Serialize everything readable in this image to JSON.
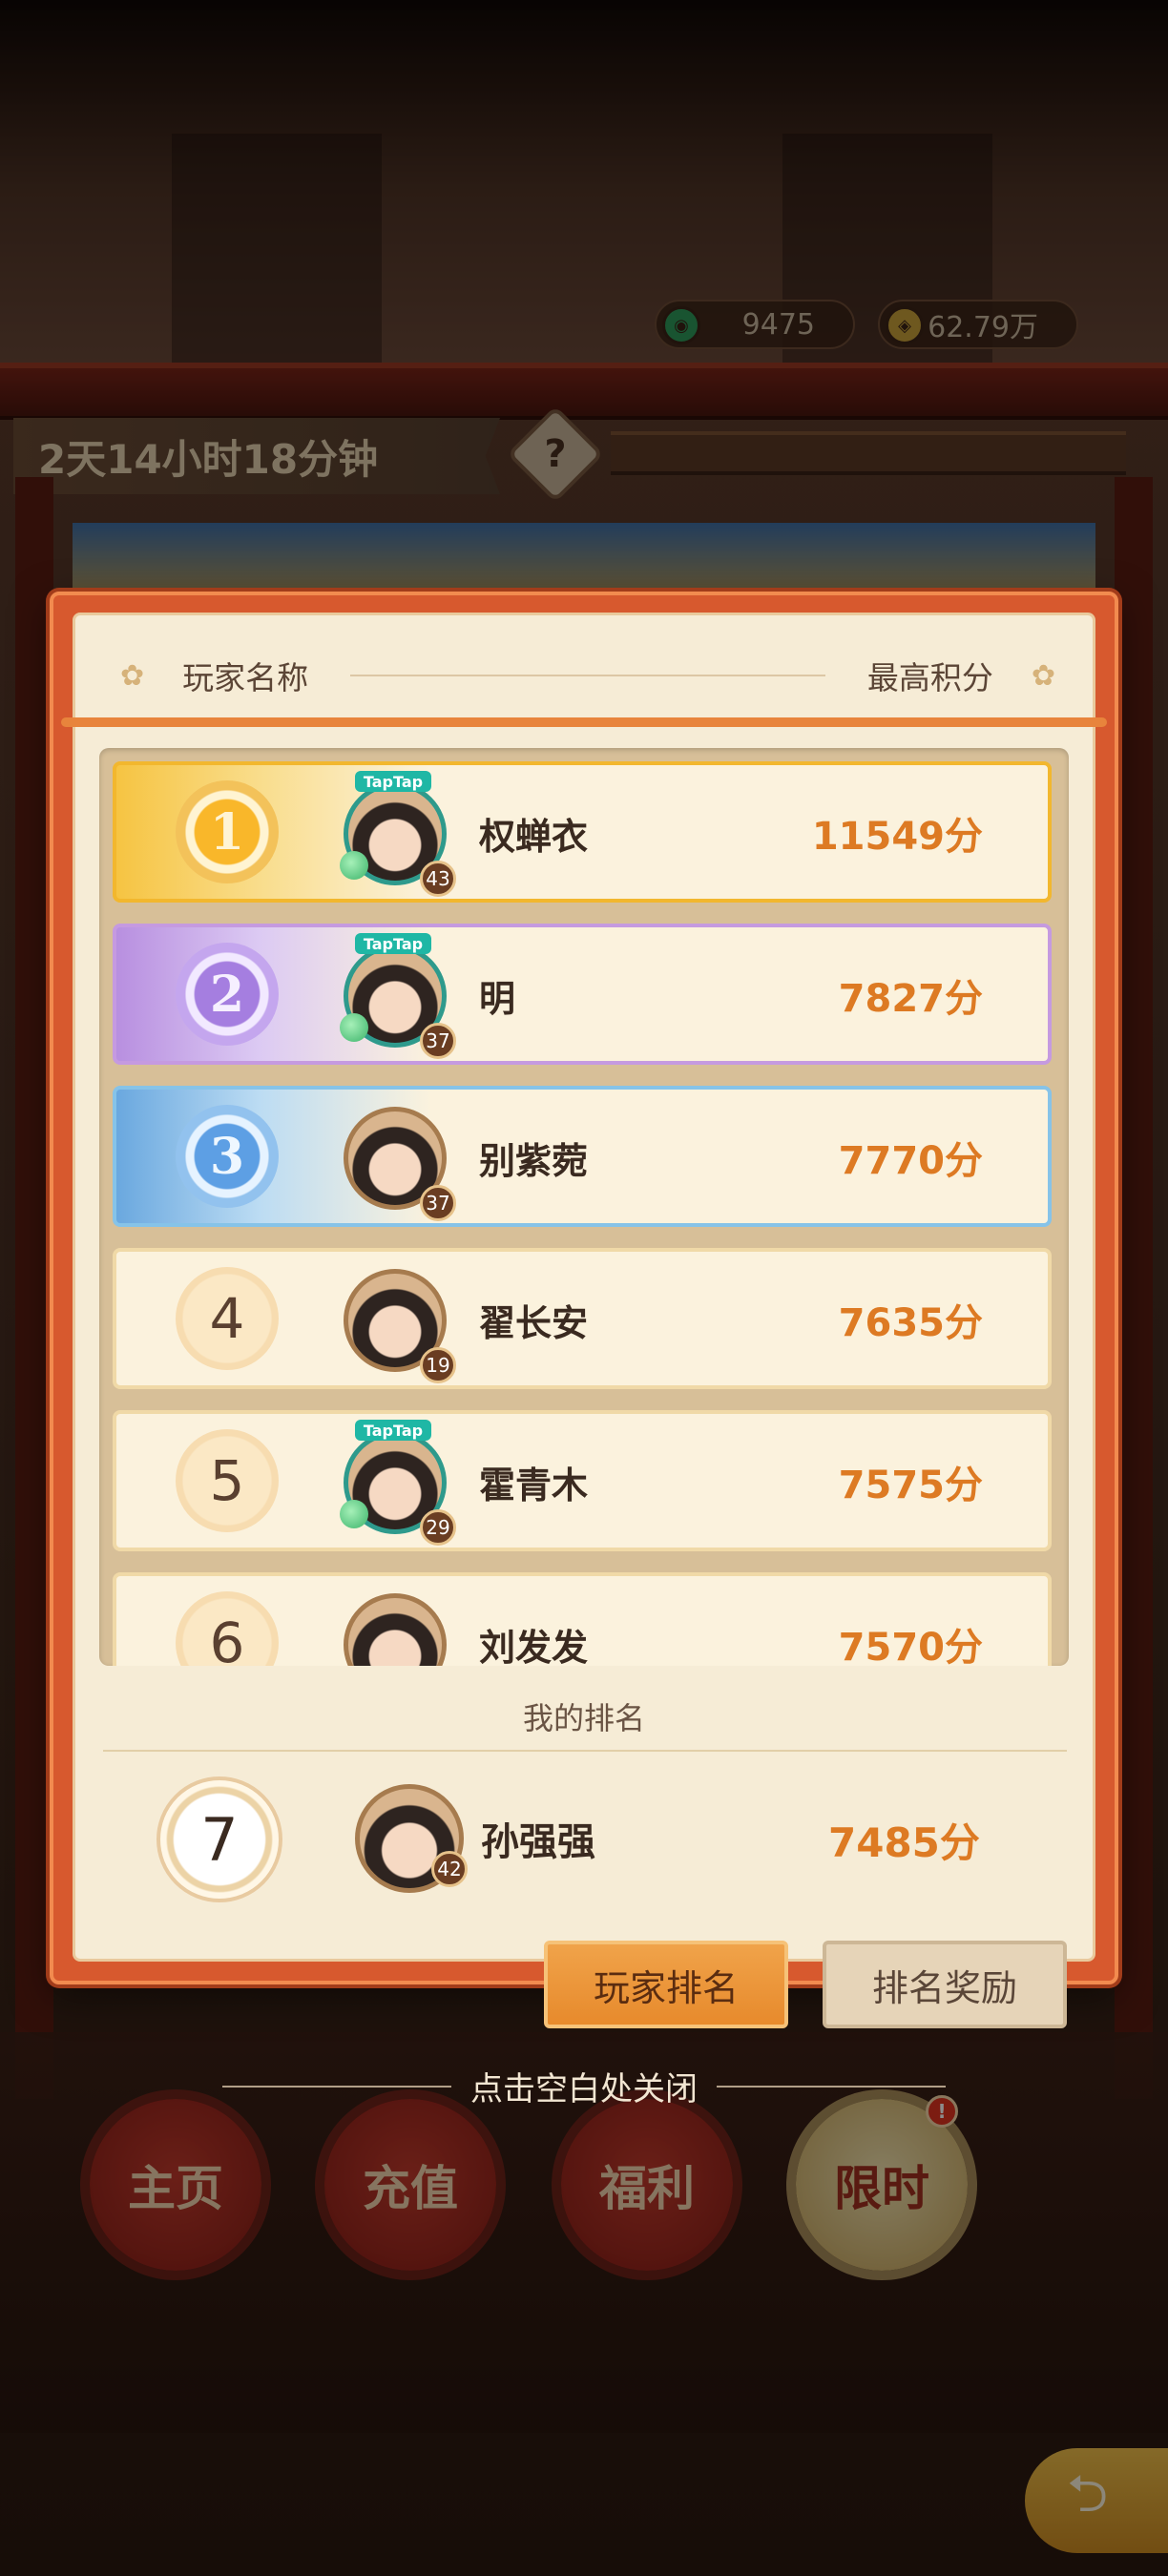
{
  "currency": [
    {
      "icon": "jade-coin-icon",
      "value": "9475"
    },
    {
      "icon": "gold-coin-icon",
      "value": "62.79万"
    }
  ],
  "event_timer": "2天14小时18分钟",
  "help_label": "?",
  "header": {
    "player_col": "玩家名称",
    "score_col": "最高积分"
  },
  "ranking": [
    {
      "rank": "1",
      "name": "权蝉衣",
      "score": "11549分",
      "level": "43",
      "tier": "gold",
      "taptap": true
    },
    {
      "rank": "2",
      "name": "明",
      "score": "7827分",
      "level": "37",
      "tier": "purple",
      "taptap": true
    },
    {
      "rank": "3",
      "name": "别紫菀",
      "score": "7770分",
      "level": "37",
      "tier": "blue",
      "taptap": false
    },
    {
      "rank": "4",
      "name": "翟长安",
      "score": "7635分",
      "level": "19",
      "tier": "plain",
      "taptap": false
    },
    {
      "rank": "5",
      "name": "霍青木",
      "score": "7575分",
      "level": "29",
      "tier": "plain",
      "taptap": true
    },
    {
      "rank": "6",
      "name": "刘发发",
      "score": "7570分",
      "level": "",
      "tier": "plain",
      "taptap": false
    }
  ],
  "taptap_label": "TapTap",
  "my_rank": {
    "label": "我的排名",
    "rank": "7",
    "name": "孙强强",
    "score": "7485分",
    "level": "42"
  },
  "tabs": {
    "active": "玩家排名",
    "inactive": "排名奖励"
  },
  "close_hint": "点击空白处关闭",
  "nav": [
    {
      "label": "主页"
    },
    {
      "label": "充值"
    },
    {
      "label": "福利"
    },
    {
      "label": "限时",
      "badge": "!"
    }
  ]
}
